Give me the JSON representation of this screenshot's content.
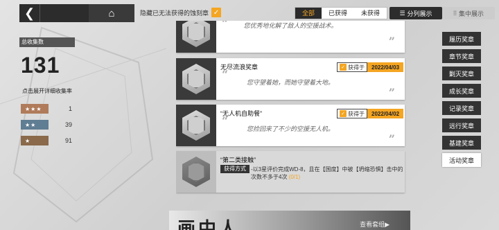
{
  "topbar": {
    "back_icon": "back-chevron-icon",
    "home_icon": "home-icon",
    "hide_label": "隐藏已无法获得的蚀刻章"
  },
  "filters": [
    "全部",
    "已获得",
    "未获得"
  ],
  "active_filter": "全部",
  "view_modes": [
    {
      "label": "分列展示",
      "icon": "list-icon",
      "active": true
    },
    {
      "label": "集中展示",
      "icon": "grid-icon",
      "active": false
    }
  ],
  "stats": {
    "title": "总收集数",
    "total": "131",
    "hint": "点击展开详细收集率",
    "rows": [
      {
        "stars": "★★★",
        "count": "1",
        "color": "#b07b5a"
      },
      {
        "stars": "★★",
        "count": "39",
        "color": "#5f7d93"
      },
      {
        "stars": "★",
        "count": "91",
        "color": "#8a6a4a"
      }
    ]
  },
  "medals": [
    {
      "title": "",
      "desc": "您优秀地化解了敌人的空援战术。",
      "obtained": false,
      "date": "",
      "locked": false
    },
    {
      "title": "无尽流浪奖章",
      "desc": "您守望着她，而她守望着大地。",
      "obtained": true,
      "got_label": "获得于",
      "date": "2022/04/03",
      "locked": false
    },
    {
      "title": "“无人机自助餐”",
      "desc": "您捡回来了不少的空援无人机。",
      "obtained": true,
      "got_label": "获得于",
      "date": "2022/04/02",
      "locked": false
    },
    {
      "title": "“第二类接触”",
      "how_label": "获得方式",
      "how_text": "-以3星评价完成WD-8，且在【国度】中被【坍缩恐惧】击中的次数不多于4次",
      "progress": "(0/1)",
      "locked": true
    }
  ],
  "categories": [
    "履历奖章",
    "章节奖章",
    "剿灭奖章",
    "成长奖章",
    "记录奖章",
    "远行奖章",
    "基建奖章",
    "活动奖章"
  ],
  "active_category": "活动奖章",
  "banner": {
    "art_text": "画中人",
    "link_label": "查看套组▶"
  }
}
